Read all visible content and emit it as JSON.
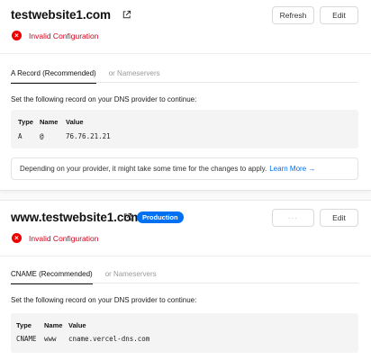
{
  "domains": [
    {
      "name": "testwebsite1.com",
      "buttons": {
        "refresh": "Refresh",
        "edit": "Edit"
      },
      "status": "Invalid Configuration",
      "tabs": [
        "A Record (Recommended)",
        "or Nameservers"
      ],
      "instruction": "Set the following record on your DNS provider to continue:",
      "record": {
        "headers": [
          "Type",
          "Name",
          "Value"
        ],
        "row": [
          "A",
          "@",
          "76.76.21.21"
        ]
      },
      "note": {
        "text": "Depending on your provider, it might take some time for the changes to apply.",
        "link": "Learn More →"
      }
    },
    {
      "name": "www.testwebsite1.com",
      "badge": "Production",
      "buttons": {
        "refresh": "···",
        "edit": "Edit"
      },
      "status": "Invalid Configuration",
      "tabs": [
        "CNAME (Recommended)",
        "or Nameservers"
      ],
      "instruction": "Set the following record on your DNS provider to continue:",
      "record": {
        "headers": [
          "Type",
          "Name",
          "Value"
        ],
        "row": [
          "CNAME",
          "www",
          "cname.vercel-dns.com"
        ]
      }
    }
  ],
  "colors": {
    "error": "#d0021b",
    "accent": "#0070f3"
  },
  "icons": {
    "external_link": "external-link-icon",
    "error": "error-x-icon"
  }
}
